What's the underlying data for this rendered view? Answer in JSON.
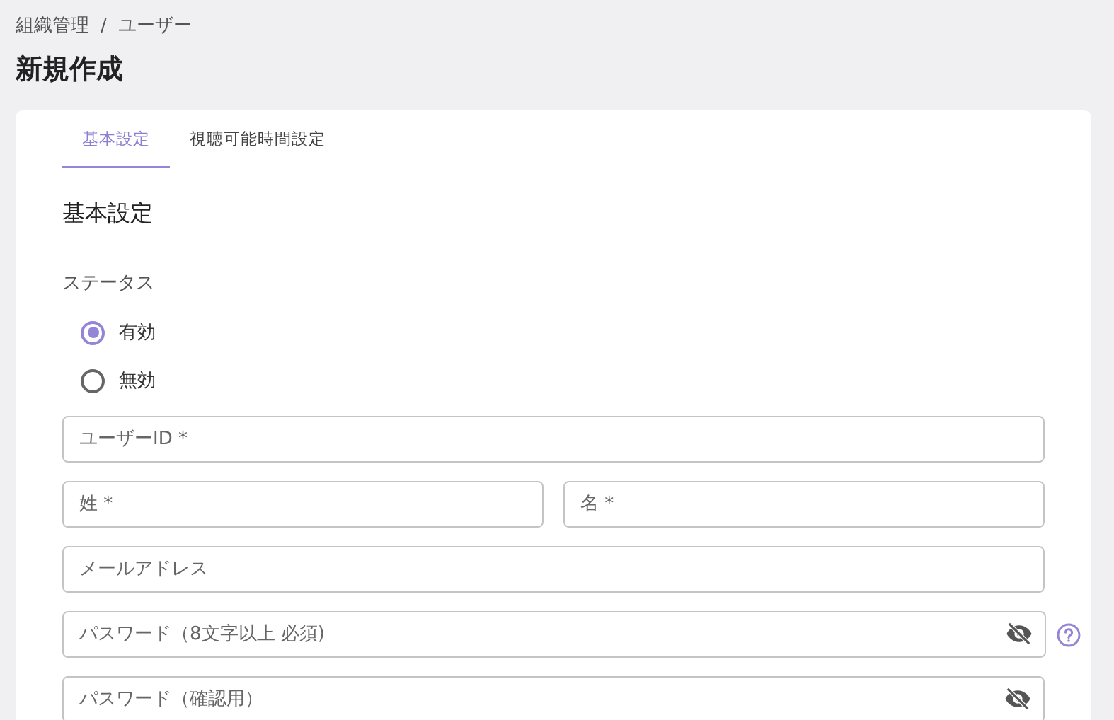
{
  "breadcrumb": {
    "items": [
      "組織管理",
      "ユーザー"
    ],
    "separator": "/"
  },
  "title": "新規作成",
  "tabs": [
    {
      "label": "基本設定",
      "selected": true
    },
    {
      "label": "視聴可能時間設定",
      "selected": false
    }
  ],
  "section_title": "基本設定",
  "status": {
    "label": "ステータス",
    "options": [
      {
        "label": "有効",
        "selected": true
      },
      {
        "label": "無効",
        "selected": false
      }
    ]
  },
  "field_rows": [
    [
      {
        "kind": "text",
        "placeholder": "ユーザーID *"
      }
    ],
    [
      {
        "kind": "text",
        "placeholder": "姓 *"
      },
      {
        "kind": "text",
        "placeholder": "名 *"
      }
    ],
    [
      {
        "kind": "text",
        "placeholder": "メールアドレス"
      }
    ],
    [
      {
        "kind": "password",
        "placeholder": "パスワード（8文字以上 必須)",
        "help": true
      }
    ],
    [
      {
        "kind": "password",
        "placeholder": "パスワード（確認用）"
      }
    ]
  ]
}
